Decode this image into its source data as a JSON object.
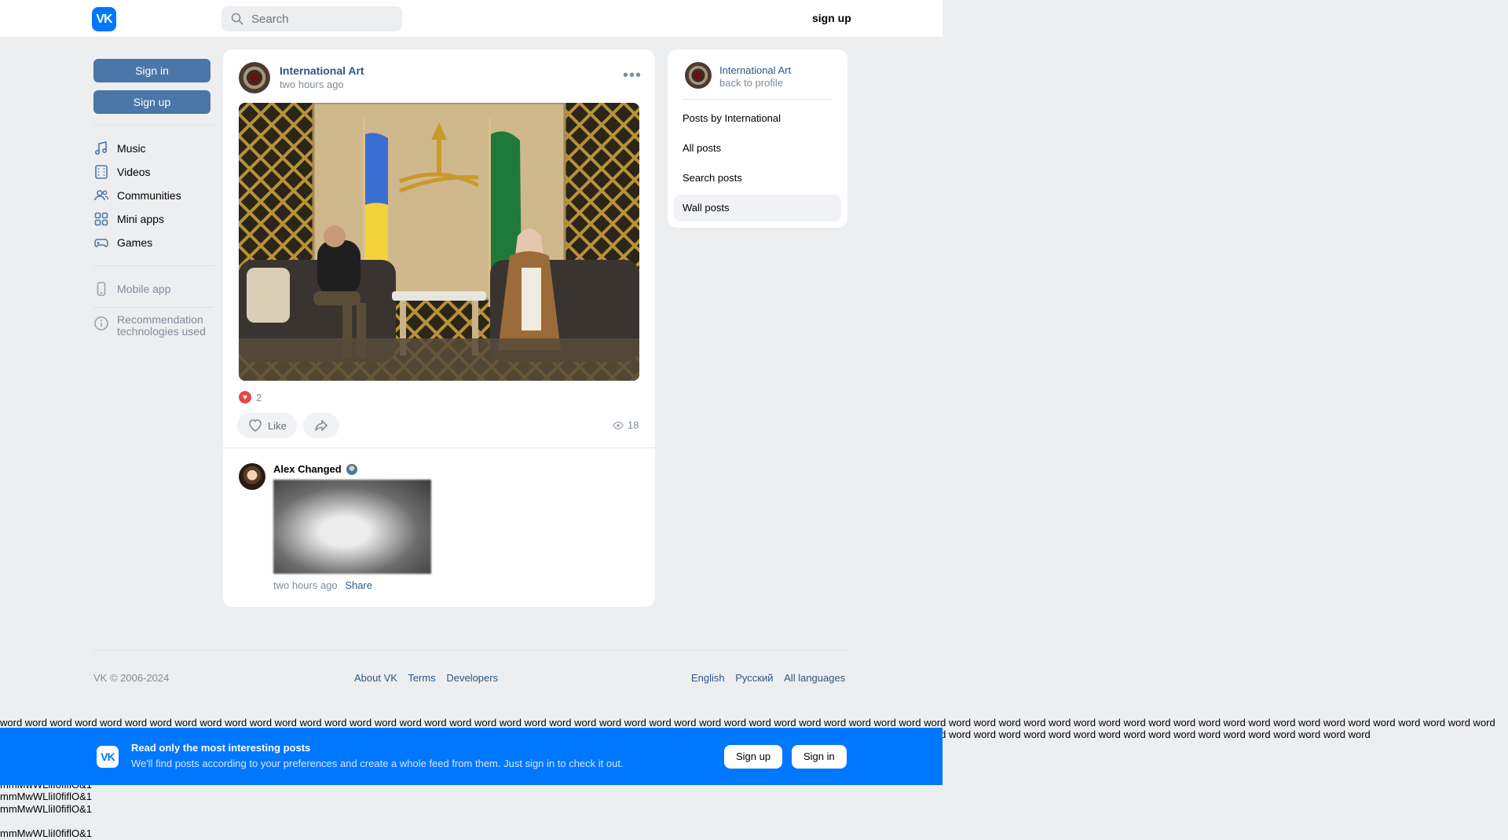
{
  "header": {
    "logo_text": "VK",
    "search_placeholder": "Search",
    "signup_label": "sign up"
  },
  "left_nav": {
    "sign_in_label": "Sign in",
    "sign_up_label": "Sign up",
    "items": [
      {
        "label": "Music",
        "icon": "music-icon"
      },
      {
        "label": "Videos",
        "icon": "video-icon"
      },
      {
        "label": "Communities",
        "icon": "communities-icon"
      },
      {
        "label": "Mini apps",
        "icon": "mini-apps-icon"
      },
      {
        "label": "Games",
        "icon": "gamepad-icon"
      }
    ],
    "mobile_app_label": "Mobile app",
    "recommendation_label": "Recommendation technologies used"
  },
  "post": {
    "author": "International Art",
    "time": "two hours ago",
    "reactions_count": "2",
    "like_label": "Like",
    "views_count": "18",
    "comment": {
      "author": "Alex Changed",
      "time": "two hours ago",
      "share_label": "Share"
    }
  },
  "right_panel": {
    "name": "International Art",
    "back_label": "back to profile",
    "menu": [
      {
        "label": "Posts by International"
      },
      {
        "label": "All posts"
      },
      {
        "label": "Search posts"
      },
      {
        "label": "Wall posts"
      }
    ]
  },
  "footer": {
    "copyright": "VK © 2006-2024",
    "links": [
      "About VK",
      "Terms",
      "Developers"
    ],
    "languages": [
      "English",
      "Русский",
      "All languages"
    ]
  },
  "banner": {
    "logo_text": "VK",
    "title": "Read only the most interesting posts",
    "subtitle": "We'll find posts according to your preferences and create a whole feed from them. Just sign in to check it out.",
    "sign_up_label": "Sign up",
    "sign_in_label": "Sign in"
  },
  "test_text": {
    "words": "word word word word word word word word word word word word word word word word word word word word word word word word word word word word word word word word word word word word word word word word word word word word word word word word word word word word word word word word word word word word word word word word word word word word word word word word word word word word word word word word word word word word word word word word word word word word word word word word word word word word word word word word word word word word word word word word word word word",
    "chars_1": "mmMwWLliI0fiflO&1",
    "chars_2": "mmMwWLliI0fiflO&1",
    "chars_3": "mmMwWLliI0fiflO&1",
    "chars_4": "mmMwWLliI0fiflO&1"
  },
  "colors": {
    "accent": "#0077ff",
    "button_blue": "#4a76a8",
    "link": "#2a5885",
    "background": "#edeef0"
  }
}
